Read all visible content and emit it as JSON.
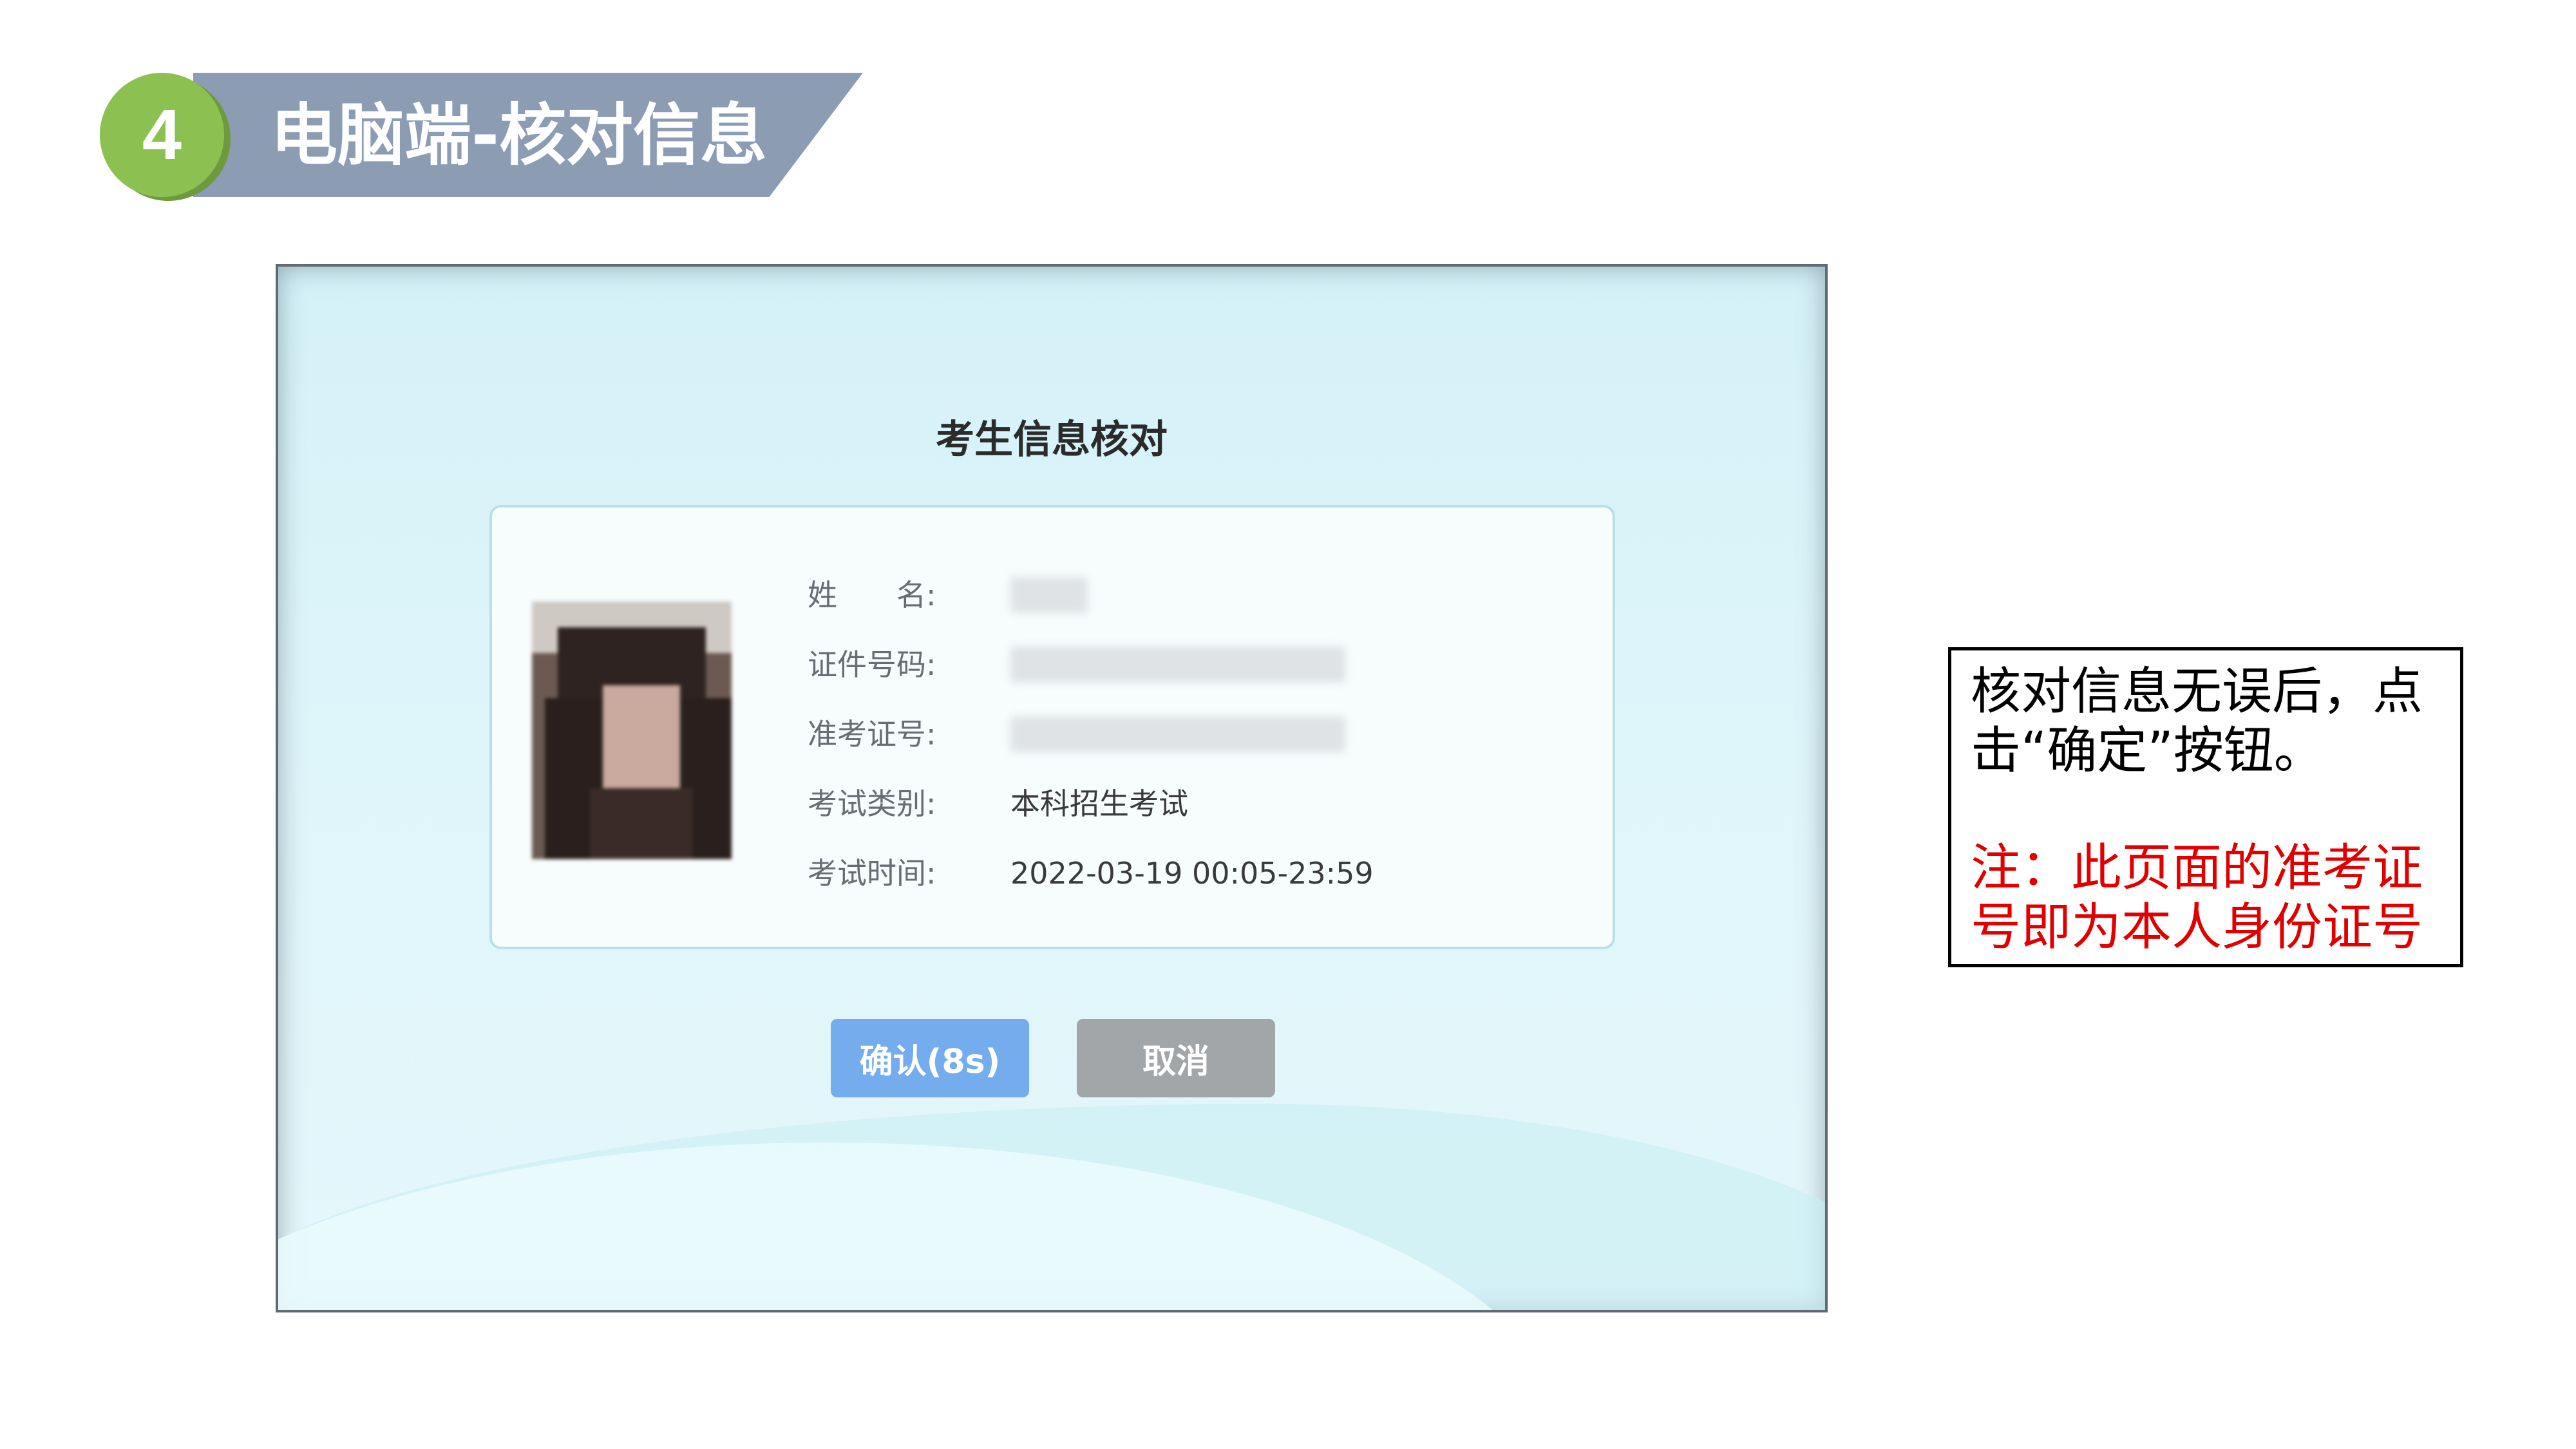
{
  "step": {
    "number": "4",
    "title": "电脑端-核对信息",
    "badge_color": "#8cc152",
    "banner_color": "#8c9cb3"
  },
  "dialog": {
    "title": "考生信息核对",
    "fields": [
      {
        "label": "姓　　名:",
        "value": ""
      },
      {
        "label": "证件号码:",
        "value": ""
      },
      {
        "label": "准考证号:",
        "value": ""
      },
      {
        "label": "考试类别:",
        "value": "本科招生考试"
      },
      {
        "label": "考试时间:",
        "value": "2022-03-19 00:05-23:59"
      }
    ],
    "confirm_button": "确认(8s)",
    "cancel_button": "取消",
    "confirm_color": "#74acee",
    "cancel_color": "#a3a6a8"
  },
  "note": {
    "lines": [
      "核对信息无误后，点",
      "击“确定”按钮。"
    ],
    "warning_lines": [
      "注：此页面的准考证",
      "号即为本人身份证号"
    ],
    "warning_color": "#e00000"
  }
}
